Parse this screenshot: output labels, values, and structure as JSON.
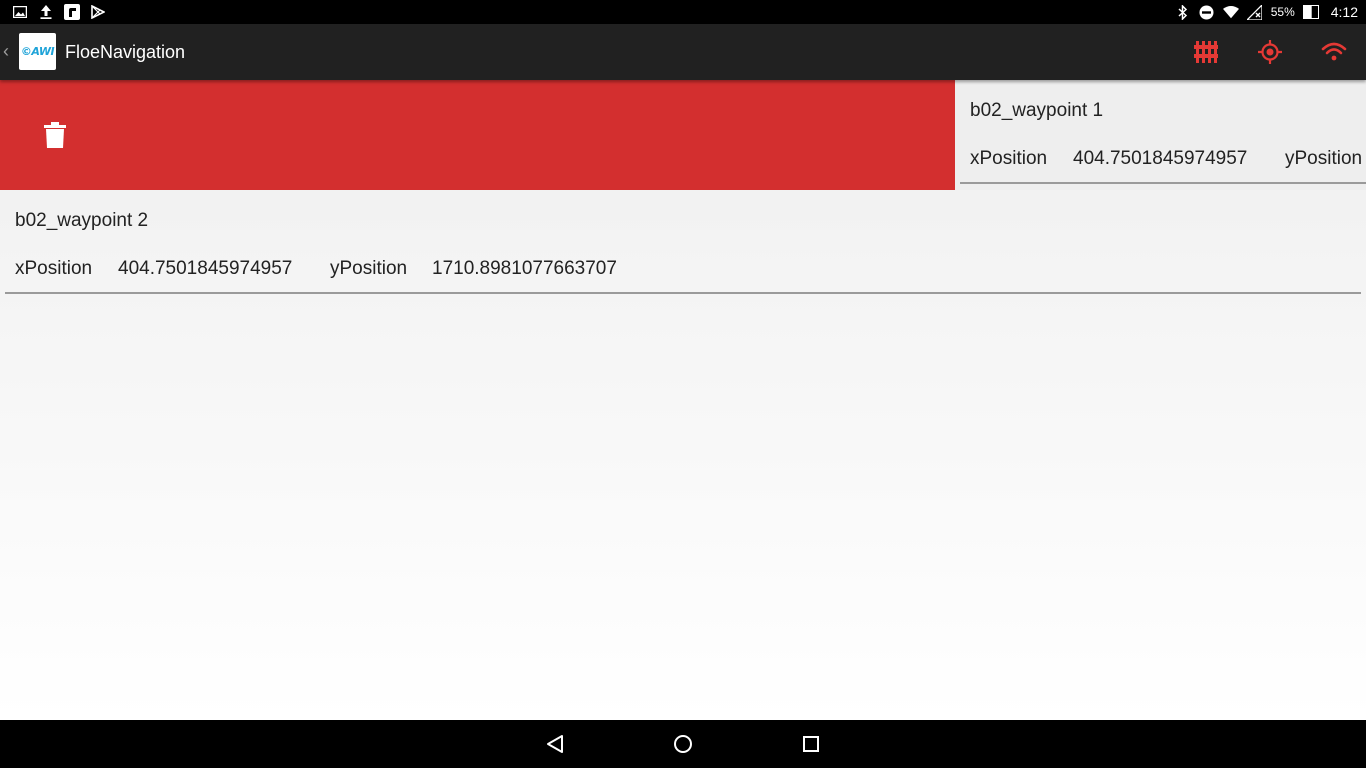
{
  "status_bar": {
    "left_icons": [
      "gallery-icon",
      "upload-icon",
      "app-icon",
      "play-store-icon"
    ],
    "right_icons": [
      "bluetooth-icon",
      "do-not-disturb-icon",
      "wifi-icon",
      "no-signal-icon"
    ],
    "battery_percent": "55%",
    "battery_level": 0.55,
    "time": "4:12"
  },
  "app_bar": {
    "title": "FloeNavigation",
    "logo_text": "©AWI",
    "actions": [
      "sliders-icon",
      "gps-target-icon",
      "wifi-icon"
    ],
    "accent_color": "#d32f2f",
    "background": "#212121"
  },
  "swipe_action": {
    "icon": "trash-icon",
    "background": "#d32f2f"
  },
  "waypoints": [
    {
      "name": "b02_waypoint 1",
      "x_label": "xPosition",
      "x_value": "404.7501845974957",
      "y_label": "yPosition"
    },
    {
      "name": "b02_waypoint 2",
      "x_label": "xPosition",
      "x_value": "404.7501845974957",
      "y_label": "yPosition",
      "y_value": "1710.8981077663707"
    }
  ],
  "nav_bar": {
    "buttons": [
      "back-icon",
      "home-icon",
      "recents-icon"
    ]
  }
}
